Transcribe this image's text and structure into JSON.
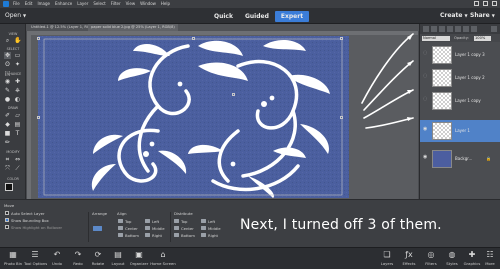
{
  "menu": {
    "items": [
      "File",
      "Edit",
      "Image",
      "Enhance",
      "Layer",
      "Select",
      "Filter",
      "View",
      "Window",
      "Help"
    ]
  },
  "modebar": {
    "open_label": "Open",
    "tabs": [
      "Quick",
      "Guided",
      "Expert"
    ],
    "active_tab": "Expert",
    "create_label": "Create",
    "share_label": "Share"
  },
  "doc_tabs": [
    "Untitled-1 @ 12.5% (Layer 1, RGB/8)",
    "paper solid blue 2.jpg @ 25% (Layer 1, RGB/8)",
    ""
  ],
  "toolbox": {
    "sections": [
      "VIEW",
      "SELECT",
      "ENHANCE",
      "DRAW",
      "MODIFY",
      "COLOR"
    ]
  },
  "layers_panel": {
    "blend_mode": "Normal",
    "opacity_label": "Opacity:",
    "opacity_value": "100%",
    "layers": [
      {
        "name": "Layer 1 copy 3",
        "visible": false,
        "thumb": "checker",
        "selected": false
      },
      {
        "name": "Layer 1 copy 2",
        "visible": false,
        "thumb": "checker",
        "selected": false
      },
      {
        "name": "Layer 1 copy",
        "visible": false,
        "thumb": "checker",
        "selected": false
      },
      {
        "name": "Layer 1",
        "visible": true,
        "thumb": "checker",
        "selected": true
      },
      {
        "name": "Backgr...",
        "visible": true,
        "thumb": "blue",
        "selected": false
      }
    ]
  },
  "tool_options": {
    "tool_name": "Move",
    "auto_select_label": "Auto Select Layer",
    "show_bbox_label": "Show Bounding Box",
    "show_highlight_label": "Show Highlight on Rollover",
    "arrange_label": "Arrange",
    "align_label": "Align",
    "align_items": [
      "Top",
      "Center",
      "Bottom",
      "Left",
      "Middle",
      "Right"
    ],
    "distribute_label": "Distribute",
    "distribute_items": [
      "Top",
      "Center",
      "Bottom",
      "Left",
      "Middle",
      "Right"
    ]
  },
  "annotation": "Next, I turned off 3 of them.",
  "taskbar": {
    "left": [
      "Photo Bin",
      "Tool Options",
      "Undo",
      "Redo",
      "Rotate",
      "Layout",
      "Organizer",
      "Home Screen"
    ],
    "right": [
      "Layers",
      "Effects",
      "Filters",
      "Styles",
      "Graphics",
      "More"
    ]
  },
  "colors": {
    "accent": "#3b7dd8",
    "document": "#4b5f9f",
    "layer_selected": "#5082c8"
  }
}
